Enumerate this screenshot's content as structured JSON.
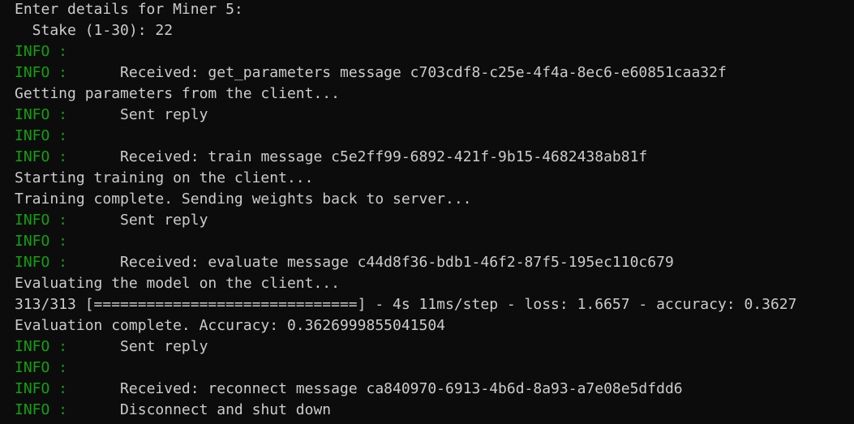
{
  "window": {
    "background": "#0c0c0c",
    "text_color": "#cccccc",
    "info_color": "#13a10e"
  },
  "lines": [
    {
      "level": "",
      "text": "Enter details for Miner 5:"
    },
    {
      "level": "",
      "text": "  Stake (1-30): 22"
    },
    {
      "level": "INFO :",
      "text": ""
    },
    {
      "level": "INFO :",
      "text": "      Received: get_parameters message c703cdf8-c25e-4f4a-8ec6-e60851caa32f"
    },
    {
      "level": "",
      "text": "Getting parameters from the client..."
    },
    {
      "level": "INFO :",
      "text": "      Sent reply"
    },
    {
      "level": "INFO :",
      "text": ""
    },
    {
      "level": "INFO :",
      "text": "      Received: train message c5e2ff99-6892-421f-9b15-4682438ab81f"
    },
    {
      "level": "",
      "text": "Starting training on the client..."
    },
    {
      "level": "",
      "text": "Training complete. Sending weights back to server..."
    },
    {
      "level": "INFO :",
      "text": "      Sent reply"
    },
    {
      "level": "INFO :",
      "text": ""
    },
    {
      "level": "INFO :",
      "text": "      Received: evaluate message c44d8f36-bdb1-46f2-87f5-195ec110c679"
    },
    {
      "level": "",
      "text": "Evaluating the model on the client..."
    },
    {
      "level": "",
      "text": "313/313 [==============================] - 4s 11ms/step - loss: 1.6657 - accuracy: 0.3627"
    },
    {
      "level": "",
      "text": "Evaluation complete. Accuracy: 0.3626999855041504"
    },
    {
      "level": "INFO :",
      "text": "      Sent reply"
    },
    {
      "level": "INFO :",
      "text": ""
    },
    {
      "level": "INFO :",
      "text": "      Received: reconnect message ca840970-6913-4b6d-8a93-a7e08e5dfdd6"
    },
    {
      "level": "INFO :",
      "text": "      Disconnect and shut down"
    }
  ]
}
